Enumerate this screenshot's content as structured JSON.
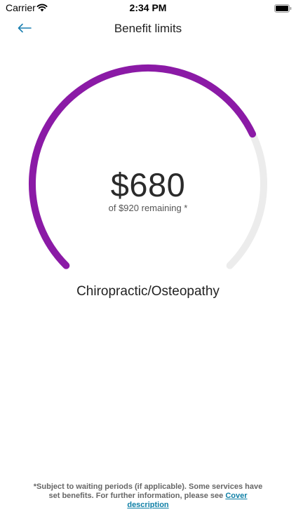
{
  "status_bar": {
    "carrier": "Carrier",
    "time": "2:34 PM"
  },
  "nav": {
    "title": "Benefit limits",
    "back_icon": "arrow-left-icon"
  },
  "benefit": {
    "remaining_amount": "$680",
    "subtext": "of $920 remaining *",
    "name": "Chiropractic/Osteopathy",
    "remaining_value": 680,
    "limit_value": 920,
    "accent_color": "#8b1aa6",
    "track_color": "#ececec"
  },
  "footer": {
    "text": "*Subject to waiting periods (if applicable). Some services have set benefits. For further information, please see ",
    "link": "Cover description"
  },
  "colors": {
    "link": "#0e7fa6",
    "back_arrow": "#1a7fb0"
  }
}
